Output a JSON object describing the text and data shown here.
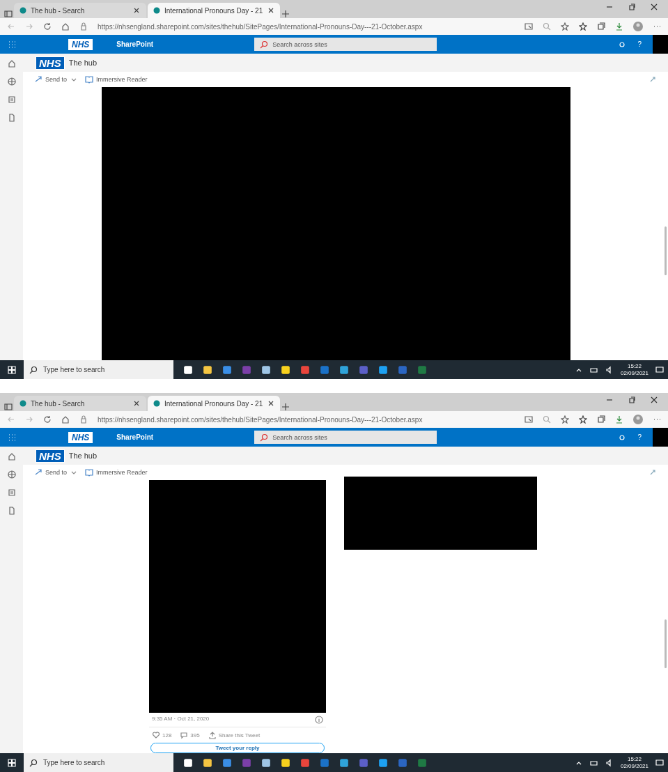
{
  "screenshots": [
    {
      "tabs": [
        {
          "title": "The hub - Search",
          "selected": false
        },
        {
          "title": "International Pronouns Day - 21",
          "selected": true
        }
      ],
      "url": "https://nhsengland.sharepoint.com/sites/thehub/SitePages/International-Pronouns-Day---21-October.aspx",
      "suite_bar": {
        "logo": "NHS",
        "app": "SharePoint",
        "search_placeholder": "Search across sites",
        "help": "?"
      },
      "site": {
        "logo": "NHS",
        "title": "The hub"
      },
      "commands": [
        "Send to",
        "Immersive Reader"
      ],
      "content": {
        "kind": "banner"
      },
      "taskbar": {
        "search_placeholder": "Type here to search",
        "time": "15:22",
        "date": "02/09/2021"
      }
    },
    {
      "tabs": [
        {
          "title": "The hub - Search",
          "selected": false
        },
        {
          "title": "International Pronouns Day - 21",
          "selected": true
        }
      ],
      "url": "https://nhsengland.sharepoint.com/sites/thehub/SitePages/International-Pronouns-Day---21-October.aspx",
      "suite_bar": {
        "logo": "NHS",
        "app": "SharePoint",
        "search_placeholder": "Search across sites",
        "help": "?"
      },
      "site": {
        "logo": "NHS",
        "title": "The hub"
      },
      "commands": [
        "Send to",
        "Immersive Reader"
      ],
      "content": {
        "kind": "embeds",
        "tweet": {
          "timestamp": "9:35 AM · Oct 21, 2020",
          "likes": "128",
          "replies": "395",
          "share": "Share this Tweet",
          "reply_button": "Tweet your reply"
        }
      },
      "taskbar": {
        "search_placeholder": "Type here to search",
        "time": "15:22",
        "date": "02/09/2021"
      }
    }
  ]
}
